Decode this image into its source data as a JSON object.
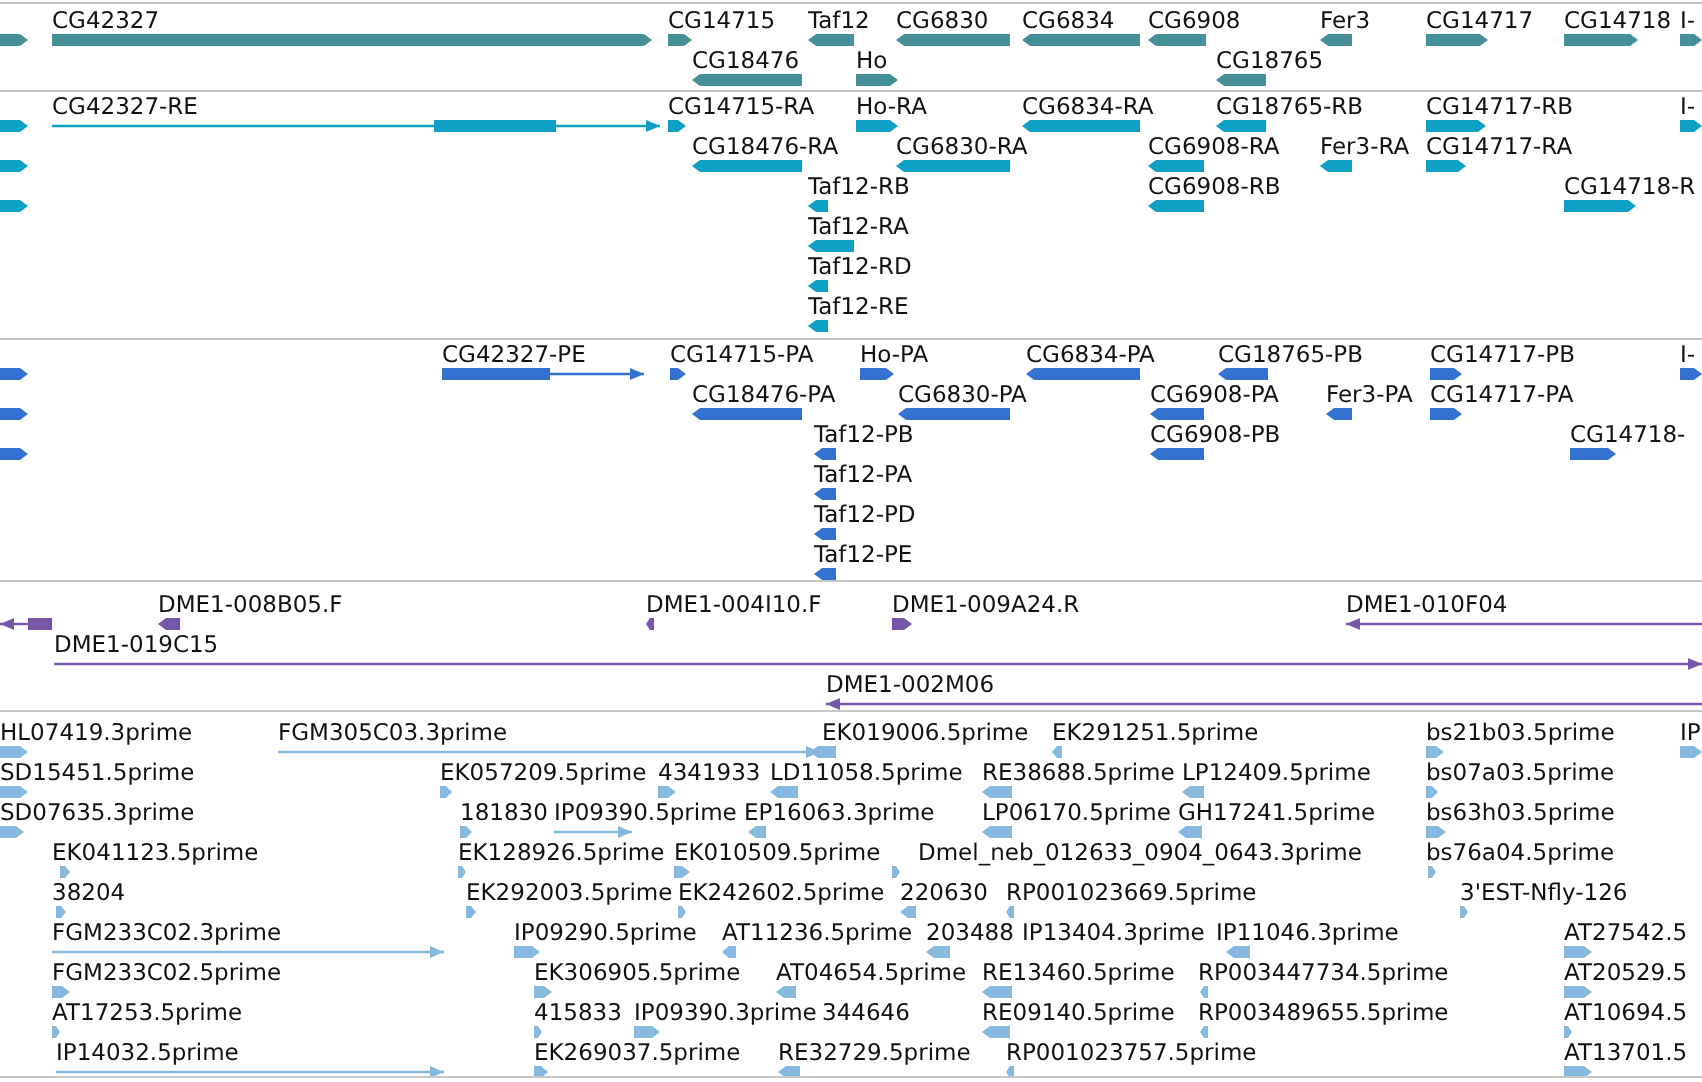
{
  "tracks": [
    {
      "color": "#448f95",
      "features": [
        {
          "reverse": false
        },
        {
          "label": "CG42327",
          "reverse": false
        },
        {
          "label": "CG14715",
          "reverse": false
        },
        {
          "label": "Taf12",
          "reverse": true
        },
        {
          "label": "CG6830",
          "reverse": true
        },
        {
          "label": "CG6834",
          "reverse": true
        },
        {
          "label": "CG6908",
          "reverse": true
        },
        {
          "label": "Fer3",
          "reverse": true
        },
        {
          "label": "CG14717",
          "reverse": false
        },
        {
          "label": "CG14718",
          "reverse": false
        },
        {
          "label": "I-",
          "reverse": false
        },
        {
          "label": "CG18476",
          "reverse": true
        },
        {
          "label": "Ho",
          "reverse": false
        },
        {
          "label": "CG18765",
          "reverse": true
        }
      ]
    },
    {
      "color": "#0fa0c6",
      "features": [
        {
          "reverse": false
        },
        {
          "label": "CG42327-RE",
          "reverse": false
        },
        {
          "label": "CG14715-RA",
          "reverse": false
        },
        {
          "label": "Ho-RA",
          "reverse": false
        },
        {
          "label": "CG6834-RA",
          "reverse": true
        },
        {
          "label": "CG18765-RB",
          "reverse": true
        },
        {
          "label": "CG14717-RB",
          "reverse": false
        },
        {
          "label": "I-",
          "reverse": false
        },
        {
          "reverse": false
        },
        {
          "label": "CG18476-RA",
          "reverse": true
        },
        {
          "label": "CG6830-RA",
          "reverse": true
        },
        {
          "label": "CG6908-RA",
          "reverse": true
        },
        {
          "label": "Fer3-RA",
          "reverse": true
        },
        {
          "label": "CG14717-RA",
          "reverse": false
        },
        {
          "reverse": false
        },
        {
          "label": "Taf12-RB",
          "reverse": true
        },
        {
          "label": "CG6908-RB",
          "reverse": true
        },
        {
          "label": "CG14718-R",
          "reverse": false
        },
        {
          "label": "Taf12-RA",
          "reverse": true
        },
        {
          "label": "Taf12-RD",
          "reverse": true
        },
        {
          "label": "Taf12-RE",
          "reverse": true
        }
      ]
    },
    {
      "color": "#3472d2",
      "features": [
        {
          "reverse": false
        },
        {
          "label": "CG42327-PE",
          "reverse": false
        },
        {
          "label": "CG14715-PA",
          "reverse": false
        },
        {
          "label": "Ho-PA",
          "reverse": false
        },
        {
          "label": "CG6834-PA",
          "reverse": true
        },
        {
          "label": "CG18765-PB",
          "reverse": true
        },
        {
          "label": "CG14717-PB",
          "reverse": false
        },
        {
          "label": "I-",
          "reverse": false
        },
        {
          "reverse": false
        },
        {
          "label": "CG18476-PA",
          "reverse": true
        },
        {
          "label": "CG6830-PA",
          "reverse": true
        },
        {
          "label": "CG6908-PA",
          "reverse": true
        },
        {
          "label": "Fer3-PA",
          "reverse": true
        },
        {
          "label": "CG14717-PA",
          "reverse": false
        },
        {
          "reverse": false
        },
        {
          "label": "Taf12-PB",
          "reverse": true
        },
        {
          "label": "CG6908-PB",
          "reverse": true
        },
        {
          "label": "CG14718-",
          "reverse": false
        },
        {
          "label": "Taf12-PA",
          "reverse": true
        },
        {
          "label": "Taf12-PD",
          "reverse": true
        },
        {
          "label": "Taf12-PE",
          "reverse": true
        }
      ]
    },
    {
      "color": "#7757aa",
      "features": [
        {
          "reverse": true
        },
        {
          "label": "DME1-008B05.F",
          "reverse": true
        },
        {
          "label": "DME1-004I10.F",
          "reverse": true
        },
        {
          "label": "DME1-009A24.R",
          "reverse": false
        },
        {
          "label": "DME1-010F04",
          "reverse": true
        },
        {
          "label": "DME1-019C15",
          "reverse": false
        },
        {
          "label": "DME1-002M06",
          "reverse": true
        }
      ]
    },
    {
      "color": "#86b9de",
      "features": [
        {
          "label": "HL07419.3prime",
          "reverse": false
        },
        {
          "label": "FGM305C03.3prime",
          "reverse": false
        },
        {
          "label": "EK019006.5prime",
          "reverse": true
        },
        {
          "label": "EK291251.5prime",
          "reverse": true
        },
        {
          "label": "bs21b03.5prime",
          "reverse": false
        },
        {
          "label": "IP",
          "reverse": false
        },
        {
          "label": "SD15451.5prime",
          "reverse": false
        },
        {
          "label": "EK057209.5prime",
          "reverse": false
        },
        {
          "label": "4341933",
          "reverse": false
        },
        {
          "label": "LD11058.5prime",
          "reverse": true
        },
        {
          "label": "RE38688.5prime",
          "reverse": true
        },
        {
          "label": "LP12409.5prime",
          "reverse": true
        },
        {
          "label": "bs07a03.5prime",
          "reverse": false
        },
        {
          "label": "SD07635.3prime",
          "reverse": false
        },
        {
          "label": "181830",
          "reverse": false
        },
        {
          "label": "IP09390.5prime",
          "reverse": false
        },
        {
          "label": "EP16063.3prime",
          "reverse": true
        },
        {
          "label": "LP06170.5prime",
          "reverse": true
        },
        {
          "label": "GH17241.5prime",
          "reverse": true
        },
        {
          "label": "bs63h03.5prime",
          "reverse": false
        },
        {
          "label": "EK041123.5prime",
          "reverse": false
        },
        {
          "label": "EK128926.5prime",
          "reverse": false
        },
        {
          "label": "EK010509.5prime",
          "reverse": false
        },
        {
          "label": "Dmel_neb_012633_0904_0643.3prime",
          "reverse": false
        },
        {
          "label": "bs76a04.5prime",
          "reverse": false
        },
        {
          "label": "38204",
          "reverse": false
        },
        {
          "label": "EK292003.5prime",
          "reverse": false
        },
        {
          "label": "EK242602.5prime",
          "reverse": false
        },
        {
          "label": "220630",
          "reverse": true
        },
        {
          "label": "RP001023669.5prime",
          "reverse": true
        },
        {
          "label": "3'EST-Nfly-126",
          "reverse": false
        },
        {
          "label": "FGM233C02.3prime",
          "reverse": false
        },
        {
          "label": "IP09290.5prime",
          "reverse": false
        },
        {
          "label": "AT11236.5prime",
          "reverse": true
        },
        {
          "label": "203488",
          "reverse": true
        },
        {
          "label": "IP13404.3prime"
        },
        {
          "label": "IP11046.3prime",
          "reverse": true
        },
        {
          "label": "AT27542.5",
          "reverse": false
        },
        {
          "label": "FGM233C02.5prime",
          "reverse": false
        },
        {
          "label": "EK306905.5prime",
          "reverse": false
        },
        {
          "label": "AT04654.5prime",
          "reverse": true
        },
        {
          "label": "RE13460.5prime",
          "reverse": true
        },
        {
          "label": "RP003447734.5prime",
          "reverse": true
        },
        {
          "label": "AT20529.5",
          "reverse": false
        },
        {
          "label": "AT17253.5prime",
          "reverse": false
        },
        {
          "label": "415833",
          "reverse": false
        },
        {
          "label": "IP09390.3prime",
          "reverse": false
        },
        {
          "label": "344646"
        },
        {
          "label": "RE09140.5prime",
          "reverse": true
        },
        {
          "label": "RP003489655.5prime",
          "reverse": true
        },
        {
          "label": "AT10694.5",
          "reverse": false
        },
        {
          "label": "IP14032.5prime",
          "reverse": false
        },
        {
          "label": "EK269037.5prime",
          "reverse": false
        },
        {
          "label": "RE32729.5prime",
          "reverse": true
        },
        {
          "label": "RP001023757.5prime",
          "reverse": true
        },
        {
          "label": "AT13701.5",
          "reverse": false
        }
      ]
    }
  ]
}
